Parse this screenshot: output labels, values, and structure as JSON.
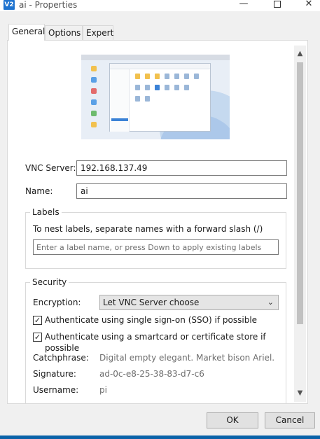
{
  "window": {
    "icon_text": "V2",
    "title": "ai - Properties",
    "minimize_glyph": "—",
    "close_glyph": "✕"
  },
  "tabs": [
    {
      "label": "General",
      "active": true
    },
    {
      "label": "Options",
      "active": false
    },
    {
      "label": "Expert",
      "active": false
    }
  ],
  "general": {
    "thumbnail_icon": "desktop-preview-image",
    "vnc_server_label": "VNC Server:",
    "vnc_server_value": "192.168.137.49",
    "name_label": "Name:",
    "name_value": "ai"
  },
  "labels_group": {
    "title": "Labels",
    "hint": "To nest labels, separate names with a forward slash (/)",
    "placeholder": "Enter a label name, or press Down to apply existing labels"
  },
  "security_group": {
    "title": "Security",
    "encryption_label": "Encryption:",
    "encryption_value": "Let VNC Server choose",
    "sso_checked": true,
    "sso_label": "Authenticate using single sign-on (SSO) if possible",
    "smartcard_checked": true,
    "smartcard_label": "Authenticate using a smartcard or certificate store if possible",
    "catchphrase_label": "Catchphrase:",
    "catchphrase_value": "Digital empty elegant. Market bison Ariel.",
    "signature_label": "Signature:",
    "signature_value": "ad-0c-e8-25-38-83-d7-c6",
    "username_label": "Username:",
    "username_value": "pi"
  },
  "buttons": {
    "ok": "OK",
    "cancel": "Cancel"
  },
  "colors": {
    "accent": "#0a62a8",
    "app_icon": "#1e73d0"
  }
}
